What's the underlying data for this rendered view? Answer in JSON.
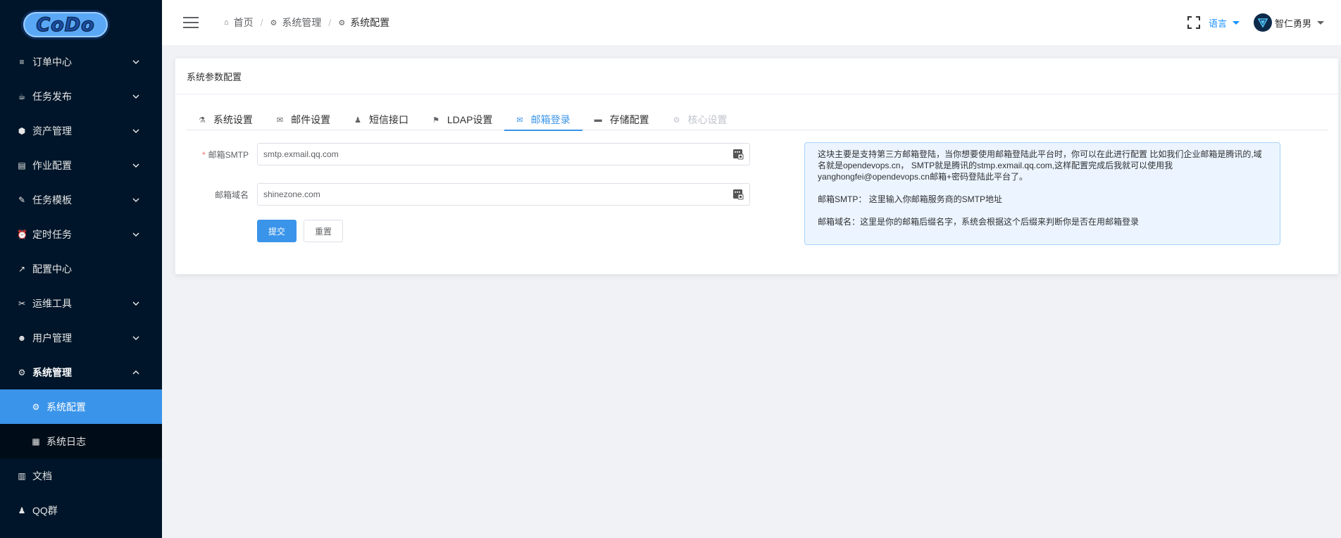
{
  "logo": {
    "text": "CoDo"
  },
  "sidebar": {
    "items": [
      {
        "label": "订单中心",
        "icon": "list-icon",
        "glyph": "≡",
        "expandable": true
      },
      {
        "label": "任务发布",
        "icon": "coffee-icon",
        "glyph": "☕",
        "expandable": true
      },
      {
        "label": "资产管理",
        "icon": "cube-icon",
        "glyph": "⬢",
        "expandable": true
      },
      {
        "label": "作业配置",
        "icon": "briefcase-icon",
        "glyph": "▤",
        "expandable": true
      },
      {
        "label": "任务模板",
        "icon": "leaf-icon",
        "glyph": "✎",
        "expandable": true
      },
      {
        "label": "定时任务",
        "icon": "alarm-icon",
        "glyph": "⏰",
        "expandable": true
      },
      {
        "label": "配置中心",
        "icon": "wrench-icon",
        "glyph": "↗",
        "expandable": false
      },
      {
        "label": "运维工具",
        "icon": "tools-icon",
        "glyph": "✂",
        "expandable": true
      },
      {
        "label": "用户管理",
        "icon": "users-icon",
        "glyph": "☻",
        "expandable": true
      },
      {
        "label": "系统管理",
        "icon": "gear-icon",
        "glyph": "⚙",
        "expandable": true,
        "expanded": true
      }
    ],
    "sub_items": [
      {
        "label": "系统配置",
        "icon": "gear-icon",
        "glyph": "⚙",
        "active": true
      },
      {
        "label": "系统日志",
        "icon": "book-icon",
        "glyph": "▦",
        "active": false
      }
    ],
    "bottom_items": [
      {
        "label": "文档",
        "icon": "book-open-icon",
        "glyph": "▥"
      },
      {
        "label": "QQ群",
        "icon": "bell-icon",
        "glyph": "♟"
      }
    ],
    "colors": {
      "background": "#001529",
      "active": "#3a94ea",
      "submenu_bg": "#000c17"
    }
  },
  "header": {
    "breadcrumb": [
      {
        "label": "首页",
        "icon": "home-icon",
        "glyph": "⌂"
      },
      {
        "label": "系统管理",
        "icon": "gear-icon",
        "glyph": "⚙"
      },
      {
        "label": "系统配置",
        "icon": "gear-icon",
        "glyph": "⚙"
      }
    ],
    "separator": "/",
    "language": "语言",
    "username": "智仁勇男"
  },
  "card": {
    "title": "系统参数配置",
    "tabs": [
      {
        "label": "系统设置",
        "icon": "flask-icon",
        "glyph": "⚗",
        "state": "normal"
      },
      {
        "label": "邮件设置",
        "icon": "envelope-icon",
        "glyph": "✉",
        "state": "normal"
      },
      {
        "label": "短信接口",
        "icon": "bell-icon",
        "glyph": "♟",
        "state": "normal"
      },
      {
        "label": "LDAP设置",
        "icon": "flag-icon",
        "glyph": "⚑",
        "state": "normal"
      },
      {
        "label": "邮箱登录",
        "icon": "envelope-icon",
        "glyph": "✉",
        "state": "active"
      },
      {
        "label": "存储配置",
        "icon": "folder-icon",
        "glyph": "▬",
        "state": "normal"
      },
      {
        "label": "核心设置",
        "icon": "gear-icon",
        "glyph": "⚙",
        "state": "disabled"
      }
    ],
    "form": {
      "smtp": {
        "label": "邮箱SMTP",
        "required_mark": "*",
        "value": "smtp.exmail.qq.com"
      },
      "domain": {
        "label": "邮箱域名",
        "value": "shinezone.com"
      },
      "submit_label": "提交",
      "reset_label": "重置"
    },
    "help": {
      "line1": "这块主要是支持第三方邮箱登陆，当你想要使用邮箱登陆此平台时，你可以在此进行配置 比如我们企业邮箱是腾讯的,域名就是opendevops.cn， SMTP就是腾讯的stmp.exmail.qq.com,这样配置完成后我就可以使用我yanghongfei@opendevops.cn邮箱+密码登陆此平台了。",
      "line2": "邮箱SMTP： 这里输入你邮箱服务商的SMTP地址",
      "line3": "邮箱域名：这里是你的邮箱后缀名字，系统会根据这个后缀来判断你是否在用邮箱登录"
    }
  }
}
